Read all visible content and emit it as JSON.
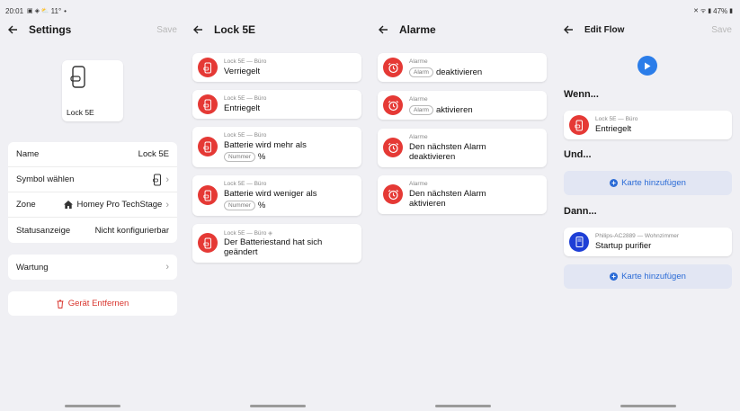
{
  "status": {
    "time": "20:01",
    "temp": "11°",
    "battery": "47%"
  },
  "settings": {
    "title": "Settings",
    "save": "Save",
    "device_label": "Lock 5E",
    "rows": [
      {
        "label": "Name",
        "value": "Lock 5E"
      },
      {
        "label": "Symbol wählen",
        "value": ""
      },
      {
        "label": "Zone",
        "value": "Homey Pro TechStage"
      },
      {
        "label": "Statusanzeige",
        "value": "Nicht konfigurierbar"
      }
    ],
    "wartung": "Wartung",
    "remove": "Gerät Entfernen"
  },
  "lock": {
    "title": "Lock 5E",
    "caption": "Lock 5E — Büro",
    "items": [
      {
        "text": "Verriegelt"
      },
      {
        "text": "Entriegelt"
      },
      {
        "text": "Batterie wird mehr als",
        "chip": "Nummer",
        "suffix": "%"
      },
      {
        "text": "Batterie wird weniger als",
        "chip": "Nummer",
        "suffix": "%"
      },
      {
        "text": "Der Batteriestand hat sich",
        "text2": "geändert"
      }
    ]
  },
  "alarme": {
    "title": "Alarme",
    "caption": "Alarme",
    "items": [
      {
        "chip": "Alarm",
        "text": "deaktivieren"
      },
      {
        "chip": "Alarm",
        "text": "aktivieren"
      },
      {
        "text": "Den nächsten Alarm",
        "text2": "deaktivieren"
      },
      {
        "text": "Den nächsten Alarm",
        "text2": "aktivieren"
      }
    ]
  },
  "flow": {
    "title": "Edit Flow",
    "save": "Save",
    "wenn": "Wenn...",
    "und": "Und...",
    "dann": "Dann...",
    "when_card": {
      "caption": "Lock 5E — Büro",
      "text": "Entriegelt"
    },
    "add1": "Karte hinzufügen",
    "then_card": {
      "caption": "Philips-AC2889 — Wohnzimmer",
      "text": "Startup purifier"
    },
    "add2": "Karte hinzufügen"
  },
  "colors": {
    "accent": "#e53935",
    "blue": "#2b6bd6",
    "purifier": "#1e3fd6"
  }
}
